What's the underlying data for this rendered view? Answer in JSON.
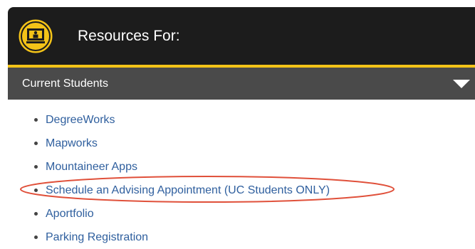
{
  "header": {
    "title": "Resources For:",
    "logo_icon": "presentation-board-icon",
    "accent_color": "#f3c318"
  },
  "section": {
    "title": "Current Students",
    "toggle_icon": "caret-down-icon"
  },
  "links": [
    {
      "label": "DegreeWorks"
    },
    {
      "label": "Mapworks"
    },
    {
      "label": "Mountaineer Apps"
    },
    {
      "label": "Schedule an Advising Appointment (UC Students ONLY)"
    },
    {
      "label": "Aportfolio"
    },
    {
      "label": "Parking Registration"
    }
  ],
  "annotation": {
    "color": "#e0503a",
    "highlighted_item": "Schedule an Advising Appointment (UC Students ONLY)"
  }
}
